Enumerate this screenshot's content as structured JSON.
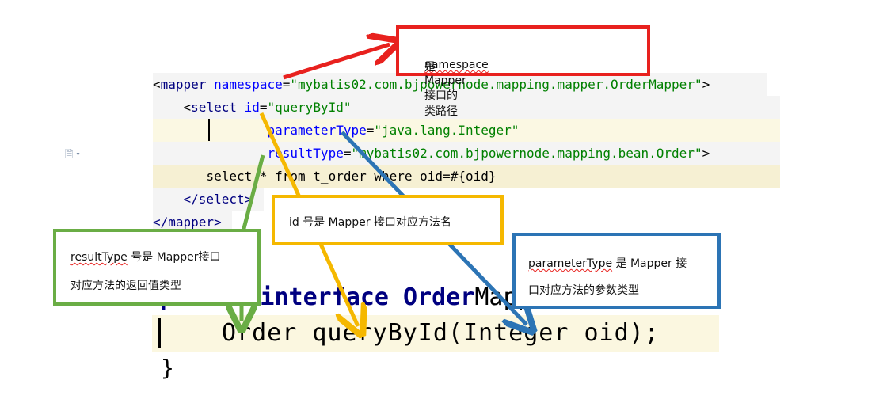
{
  "xml_code": {
    "line0": {
      "open": "<",
      "tag": "mapper",
      "attr": " namespace",
      "eq": "=",
      "val": "\"mybatis02.com.bjpowernode.mapping.mapper.OrderMapper\"",
      "close": ">"
    },
    "line1": {
      "open": "<",
      "tag": "select",
      "attr": " id",
      "eq": "=",
      "val": "\"queryById\""
    },
    "line2": {
      "attr": "parameterType",
      "eq": "=",
      "val": "\"java.lang.Integer\""
    },
    "line3": {
      "attr": "resultType",
      "eq": "=",
      "val": "\"mybatis02.com.bjpowernode.mapping.bean.Order\"",
      "close": ">"
    },
    "line4": {
      "text": "select * from t_order where oid=#{oid}"
    },
    "line5": {
      "text": "</select>"
    },
    "line6": {
      "text": "</mapper>"
    }
  },
  "java_code": {
    "line1_kw": "public interface Order",
    "line1_rest": "Mapper {",
    "line2": "Order queryById(Integer oid);",
    "line3": "}"
  },
  "annotations": {
    "namespace": {
      "word": "namespace",
      "rest": " 是 Mapper 接口的类路径",
      "color": "#e8211e"
    },
    "id": {
      "text": "id 号是 Mapper 接口对应方法名",
      "color": "#f5b800"
    },
    "resultType": {
      "word": "resultType",
      "rest": " 号是 Mapper接口",
      "line2": "对应方法的返回值类型",
      "color": "#6aad45"
    },
    "parameterType": {
      "word": "parameterType",
      "rest": " 是 Mapper 接",
      "line2": "口对应方法的参数类型",
      "color": "#2c74b5"
    }
  },
  "icons": {
    "doc": "document-icon"
  }
}
